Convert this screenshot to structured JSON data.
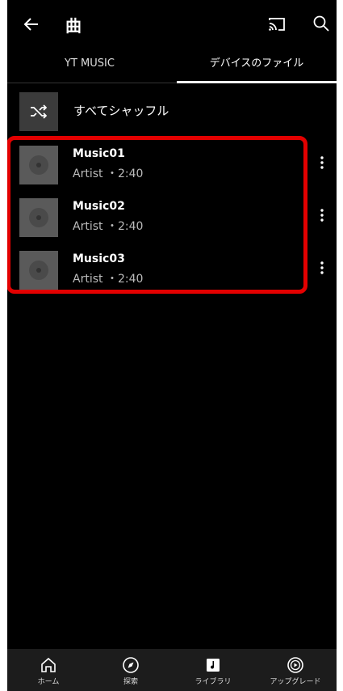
{
  "appbar": {
    "title": "曲"
  },
  "tabs": [
    {
      "label": "YT MUSIC",
      "active": false
    },
    {
      "label": "デバイスのファイル",
      "active": true
    }
  ],
  "shuffle": {
    "label": "すべてシャッフル"
  },
  "songs": [
    {
      "title": "Music01",
      "meta": "Artist ・2:40"
    },
    {
      "title": "Music02",
      "meta": "Artist ・2:40"
    },
    {
      "title": "Music03",
      "meta": "Artist ・2:40"
    }
  ],
  "highlight_color": "#e30000",
  "bottom_nav": [
    {
      "label": "ホーム",
      "icon": "home-icon"
    },
    {
      "label": "探索",
      "icon": "compass-icon"
    },
    {
      "label": "ライブラリ",
      "icon": "library-icon"
    },
    {
      "label": "アップグレード",
      "icon": "upgrade-icon"
    }
  ]
}
